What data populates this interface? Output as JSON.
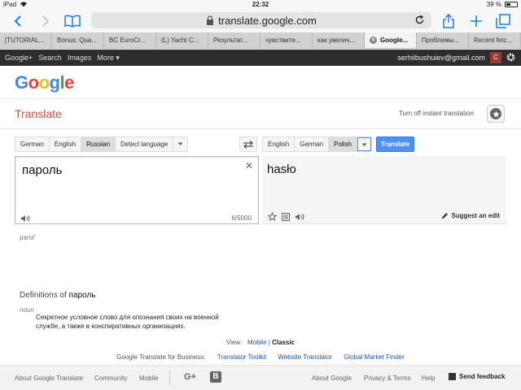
{
  "status_bar": {
    "device": "iPad",
    "time": "22:32",
    "battery": "39 %",
    "battery_level_pct": 39
  },
  "browser": {
    "url": "translate.google.com",
    "tabs": [
      {
        "label": "[TUTORIAL..."
      },
      {
        "label": "Bonus: Qua..."
      },
      {
        "label": "BC EuroCr..."
      },
      {
        "label": "(L) Yacht C..."
      },
      {
        "label": "Результат..."
      },
      {
        "label": "чувствите..."
      },
      {
        "label": "как увелич..."
      },
      {
        "label": "Google...",
        "active": true
      },
      {
        "label": "Проблемы..."
      },
      {
        "label": "Recent fetc..."
      }
    ]
  },
  "google_bar": {
    "links": [
      "Google+",
      "Search",
      "Images",
      "More ▾"
    ],
    "email": "serhiibushuiev@gmail.com",
    "avatar_letter": "C"
  },
  "logo": {
    "letters": [
      {
        "ch": "G",
        "color": "#4285f4"
      },
      {
        "ch": "o",
        "color": "#ea4335"
      },
      {
        "ch": "o",
        "color": "#fbbc05"
      },
      {
        "ch": "g",
        "color": "#4285f4"
      },
      {
        "ch": "l",
        "color": "#34a853"
      },
      {
        "ch": "e",
        "color": "#ea4335"
      }
    ]
  },
  "translate": {
    "title": "Translate",
    "instant_toggle": "Turn off instant translation",
    "source_langs": [
      "German",
      "English",
      "Russian",
      "Detect language"
    ],
    "source_selected": "Russian",
    "target_langs": [
      "English",
      "German",
      "Polish"
    ],
    "target_selected": "Polish",
    "translate_button": "Translate",
    "source_text": "пароль",
    "char_count": "6/5000",
    "result_text": "hasło",
    "suggest_edit": "Suggest an edit",
    "transliteration": "parol'"
  },
  "definitions": {
    "title_prefix": "Definitions of ",
    "word": "пароль",
    "pos": "noun",
    "text": "Секретное условное слово для опознания своих на военной службе, а также в конспиративных организациях."
  },
  "view": {
    "label": "View:",
    "mobile": "Mobile",
    "separator": "|",
    "classic": "Classic"
  },
  "business": {
    "label": "Google Translate for Business:",
    "links": [
      "Translator Toolkit",
      "Website Translator",
      "Global Market Finder"
    ]
  },
  "footer": {
    "about_translate": "About Google Translate",
    "community": "Community",
    "mobile": "Mobile",
    "gplus": "G+",
    "blogger": "B",
    "about_google": "About Google",
    "privacy": "Privacy & Terms",
    "help": "Help",
    "send_feedback": "Send feedback"
  },
  "colors": {
    "accent_blue": "#4d90fe",
    "translate_red": "#dd4b39",
    "ios_blue": "#1a7cf5"
  }
}
